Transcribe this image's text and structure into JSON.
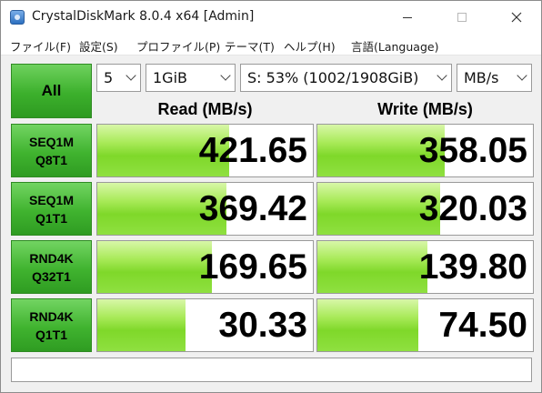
{
  "window": {
    "title": "CrystalDiskMark 8.0.4 x64 [Admin]",
    "icon": "crystaldiskmark-app-icon"
  },
  "menu": [
    "ファイル(F)",
    "設定(S)",
    "プロファイル(P)",
    "テーマ(T)",
    "ヘルプ(H)",
    "言語(Language)"
  ],
  "controls": {
    "all_label": "All",
    "count": "5",
    "size": "1GiB",
    "drive": "S: 53% (1002/1908GiB)",
    "unit": "MB/s"
  },
  "headers": {
    "read": "Read (MB/s)",
    "write": "Write (MB/s)"
  },
  "results": [
    {
      "line1": "SEQ1M",
      "line2": "Q8T1",
      "read": "421.65",
      "write": "358.05",
      "read_fill": 0.61,
      "write_fill": 0.59
    },
    {
      "line1": "SEQ1M",
      "line2": "Q1T1",
      "read": "369.42",
      "write": "320.03",
      "read_fill": 0.6,
      "write_fill": 0.57
    },
    {
      "line1": "RND4K",
      "line2": "Q32T1",
      "read": "169.65",
      "write": "139.80",
      "read_fill": 0.53,
      "write_fill": 0.51
    },
    {
      "line1": "RND4K",
      "line2": "Q1T1",
      "read": "30.33",
      "write": "74.50",
      "read_fill": 0.41,
      "write_fill": 0.47
    }
  ],
  "status_text": "",
  "colors": {
    "button_green": "#3cb02c",
    "bar_green": "#7fd82a"
  }
}
